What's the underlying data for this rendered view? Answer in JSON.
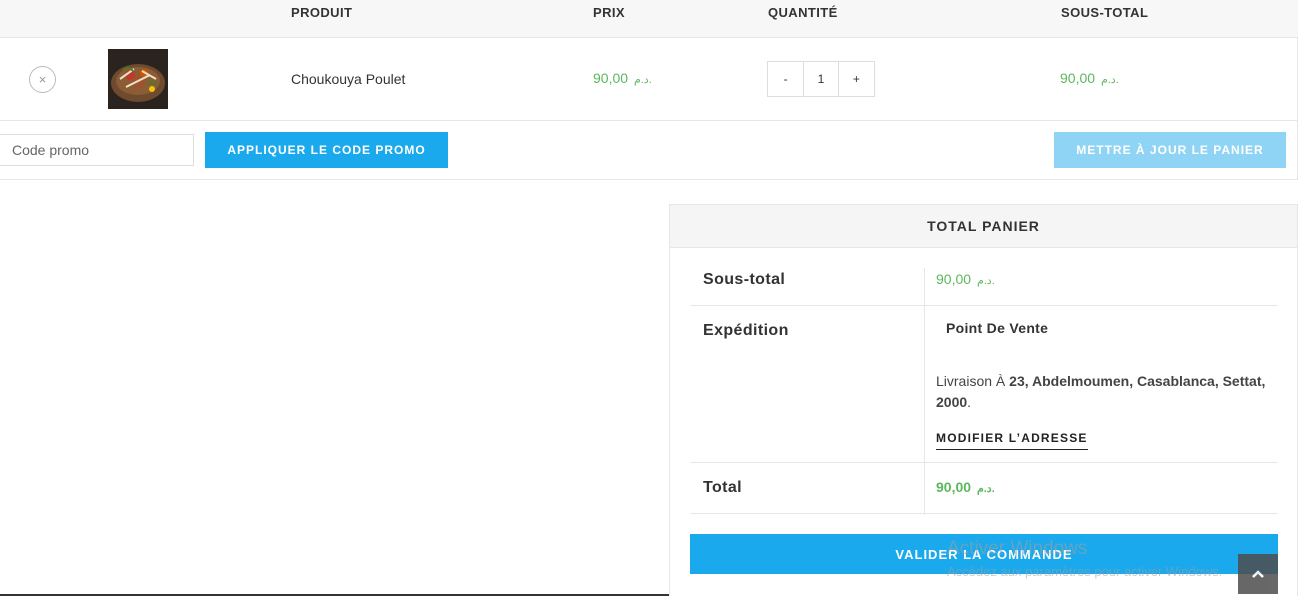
{
  "cart": {
    "headers": {
      "product": "PRODUIT",
      "price": "PRIX",
      "quantity": "QUANTITÉ",
      "subtotal": "SOUS-TOTAL"
    },
    "item": {
      "remove_glyph": "×",
      "name": "Choukouya Poulet",
      "price": "90,00",
      "currency": "د.م.",
      "quantity": "1",
      "minus": "-",
      "plus": "+",
      "subtotal": "90,00"
    }
  },
  "actions": {
    "promo_placeholder": "Code promo",
    "apply_label": "APPLIQUER LE CODE PROMO",
    "update_label": "METTRE À JOUR LE PANIER"
  },
  "totals": {
    "title": "TOTAL PANIER",
    "subtotal_label": "Sous-total",
    "subtotal_value": "90,00",
    "shipping_label": "Expédition",
    "shipping_method": "Point De Vente",
    "shipping_prefix": "Livraison À",
    "shipping_address": "23, Abdelmoumen, Casablanca, Settat, 2000",
    "shipping_suffix": ".",
    "change_address": "MODIFIER L’ADRESSE",
    "total_label": "Total",
    "total_value": "90,00",
    "currency": "د.م.",
    "checkout_label": "VALIDER LA COMMANDE"
  },
  "watermark": {
    "line1": "Activer Windows",
    "line2": "Accédez aux paramètres pour activer Windows."
  },
  "icons": {
    "remove": "close-icon",
    "back_to_top": "chevron-up-icon",
    "thumbnail": "product-image"
  },
  "colors": {
    "accent": "#1aa9ed",
    "price": "#5cb85c",
    "update_btn": "#8fd4f4"
  }
}
